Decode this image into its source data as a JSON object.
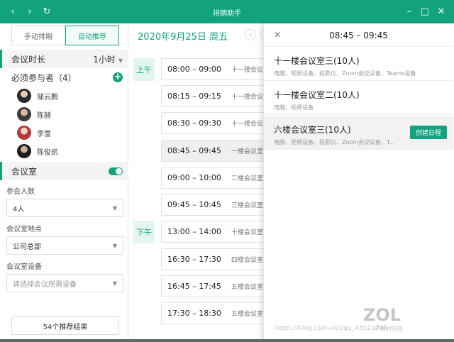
{
  "window": {
    "title": "排期助手"
  },
  "left": {
    "tabs": [
      {
        "label": "手动排期"
      },
      {
        "label": "自动推荐"
      }
    ],
    "duration": {
      "label": "会议时长",
      "value": "1小时"
    },
    "attendees": {
      "label": "必须参与者（4）",
      "people": [
        "邹云鹏",
        "陈赫",
        "李雪",
        "陈俊凯"
      ]
    },
    "room_section": {
      "label": "会议室"
    },
    "fields": [
      {
        "label": "参会人数",
        "value": "4人"
      },
      {
        "label": "会议室地点",
        "value": "公司总部"
      },
      {
        "label": "会议室设备",
        "value": "请选择会议所需设备"
      }
    ],
    "results_button": "54个推荐结果"
  },
  "middle": {
    "date": "2020年9月25日 周五",
    "am_label": "上午",
    "pm_label": "下午",
    "slots": [
      {
        "time": "08:00 – 09:00",
        "room": "十一楼会议"
      },
      {
        "time": "08:15 – 09:15",
        "room": "十一楼会议"
      },
      {
        "time": "08:30 – 09:30",
        "room": "十一楼会议"
      },
      {
        "time": "08:45 – 09:45",
        "room": "一楼会议室"
      },
      {
        "time": "09:00 – 10:00",
        "room": "二楼会议室"
      },
      {
        "time": "09:45 – 10:45",
        "room": "三楼会议室"
      },
      {
        "time": "13:00 – 14:00",
        "room": "十楼会议室"
      },
      {
        "time": "16:30 – 17:30",
        "room": "四楼会议室"
      },
      {
        "time": "16:45 – 17:45",
        "room": "五楼会议室"
      },
      {
        "time": "17:30 – 18:30",
        "room": "五楼会议室"
      }
    ]
  },
  "panel": {
    "title": "08:45 – 09:45",
    "rooms": [
      {
        "name": "十一楼会议室三(10人)",
        "features": "电脑、视频设备、投影仪、Zoom会议设备、Teams设备"
      },
      {
        "name": "十一楼会议室二(10人)",
        "features": "电脑、视频设备"
      },
      {
        "name": "六楼会议室三(10人)",
        "features": "电脑、视频设备、投影仪、Zoom会议设备、T..."
      }
    ],
    "create_button": "创建日程"
  },
  "watermark": {
    "logo": "ZOL",
    "sub": "中关村在线",
    "url": "https://blog.csdn.net/qq_43121795"
  },
  "colors": {
    "accent": "#12a37c",
    "titlebar": "#12a37c"
  },
  "icons": [
    "back-icon",
    "forward-icon",
    "refresh-icon",
    "minimize-icon",
    "maximize-icon",
    "close-icon",
    "plus-icon",
    "chevron-left-icon",
    "chevron-right-icon"
  ]
}
